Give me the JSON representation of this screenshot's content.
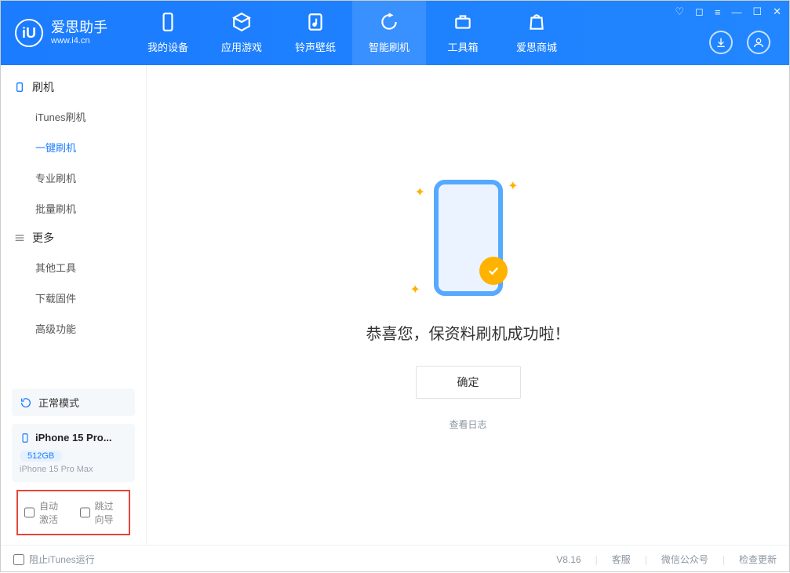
{
  "app": {
    "name": "爱思助手",
    "site": "www.i4.cn"
  },
  "topnav": {
    "items": [
      {
        "label": "我的设备"
      },
      {
        "label": "应用游戏"
      },
      {
        "label": "铃声壁纸"
      },
      {
        "label": "智能刷机"
      },
      {
        "label": "工具箱"
      },
      {
        "label": "爱思商城"
      }
    ],
    "activeIndex": 3
  },
  "sidebar": {
    "groups": [
      {
        "title": "刷机",
        "items": [
          "iTunes刷机",
          "一键刷机",
          "专业刷机",
          "批量刷机"
        ],
        "activeIndex": 1
      },
      {
        "title": "更多",
        "items": [
          "其他工具",
          "下载固件",
          "高级功能"
        ]
      }
    ],
    "mode": "正常模式",
    "device": {
      "name": "iPhone 15 Pro...",
      "storage": "512GB",
      "model": "iPhone 15 Pro Max"
    },
    "redbox": {
      "autoActivate": "自动激活",
      "skipGuide": "跳过向导"
    }
  },
  "main": {
    "title": "恭喜您，保资料刷机成功啦！",
    "confirm": "确定",
    "viewLog": "查看日志"
  },
  "footer": {
    "blockItunes": "阻止iTunes运行",
    "version": "V8.16",
    "support": "客服",
    "wechat": "微信公众号",
    "update": "检查更新"
  }
}
